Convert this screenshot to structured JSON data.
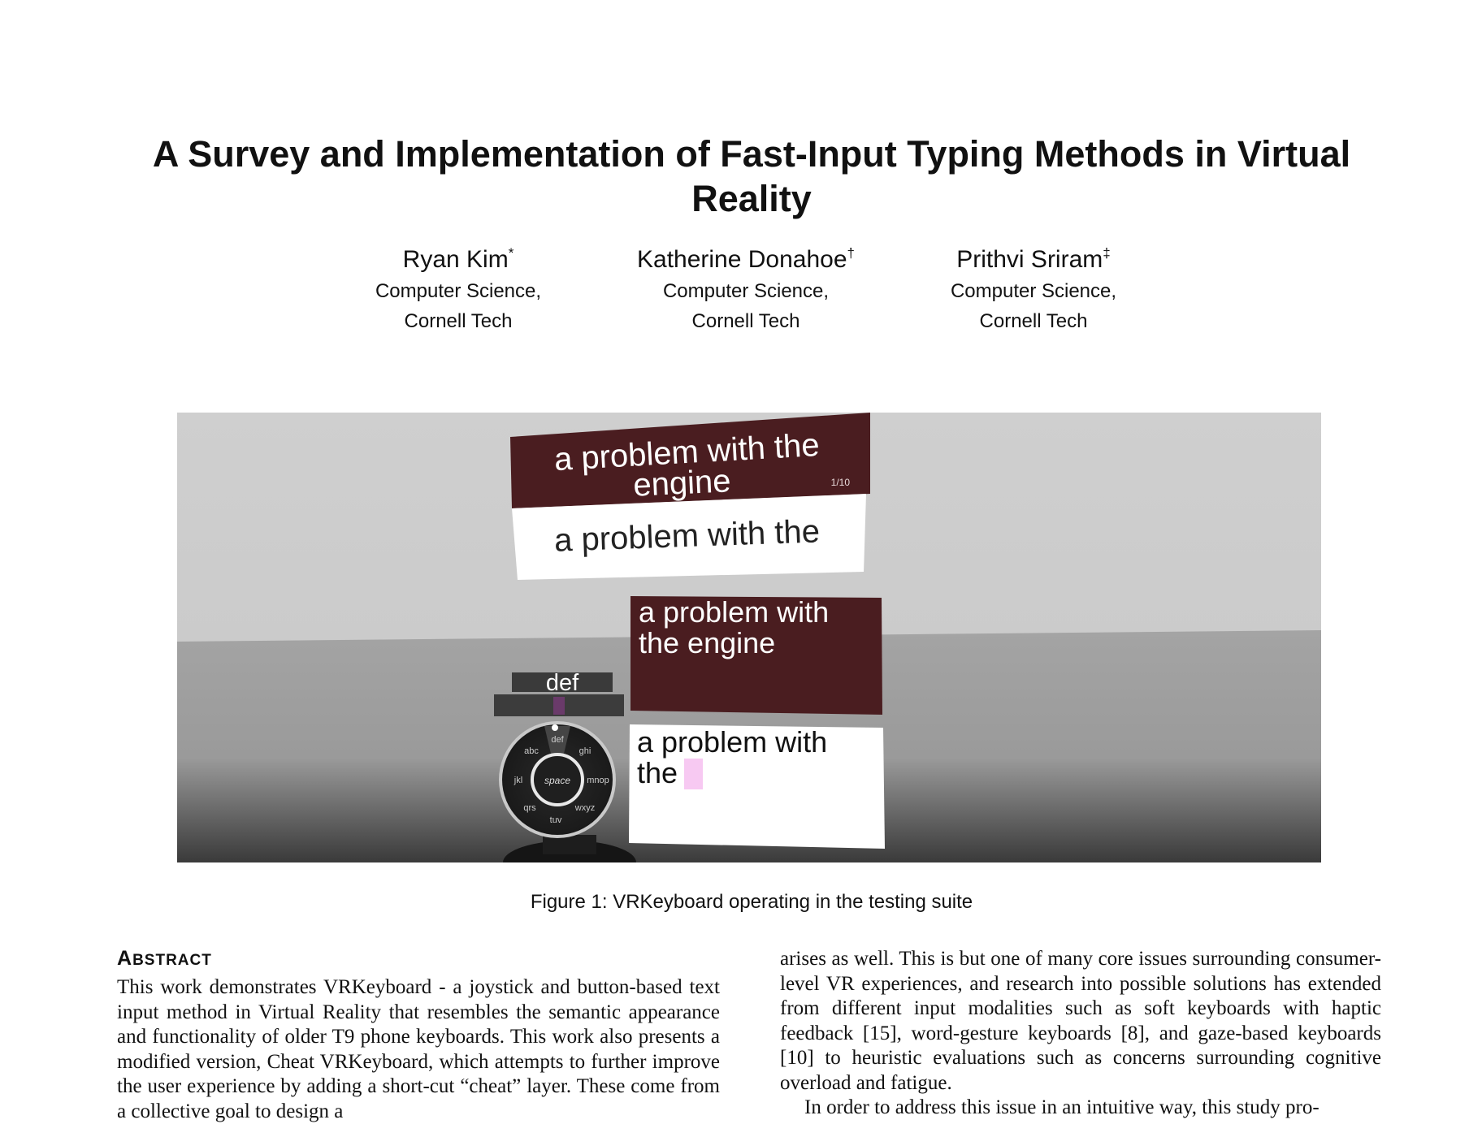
{
  "paper": {
    "title": "A Survey and Implementation of Fast-Input Typing Methods in Virtual Reality",
    "authors": [
      {
        "name": "Ryan Kim",
        "mark": "*",
        "aff1": "Computer Science,",
        "aff2": "Cornell Tech"
      },
      {
        "name": "Katherine Donahoe",
        "mark": "†",
        "aff1": "Computer Science,",
        "aff2": "Cornell Tech"
      },
      {
        "name": "Prithvi Sriram",
        "mark": "‡",
        "aff1": "Computer Science,",
        "aff2": "Cornell Tech"
      }
    ]
  },
  "figure": {
    "caption": "Figure 1: VRKeyboard operating in the testing suite",
    "target_phrase_line1": "a problem with the",
    "target_phrase_line2": "engine",
    "counter": "1/10",
    "typed_phrase": "a problem with the",
    "panel2_target_line1": "a problem with",
    "panel2_target_line2": "the engine",
    "panel2_typed_line1": "a problem with",
    "panel2_typed_line2": "the",
    "selected_group": "def",
    "dial": {
      "center": "space",
      "groups": [
        "def",
        "ghi",
        "mnop",
        "wxyz",
        "tuv",
        "qrs",
        "jkl",
        "abc"
      ]
    },
    "colors": {
      "wall": "#cdcdcd",
      "floor": "#9e9e9e",
      "panel_dark": "#4a1d20",
      "cursor": "#f7c9f2"
    }
  },
  "abstract": {
    "heading_first": "A",
    "heading_rest": "BSTRACT",
    "text": "This work demonstrates VRKeyboard - a joystick and button-based text input method in Virtual Reality that resembles the semantic appearance and functionality of older T9 phone keyboards. This work also presents a modified version, Cheat VRKeyboard, which attempts to further improve the user experience by adding a short-cut “cheat” layer. These come from a collective goal to design a"
  },
  "right_column": {
    "para1": "arises as well. This is but one of many core issues surrounding consumer-level VR experiences, and research into possible solutions has extended from different input modalities such as soft keyboards with haptic feedback [15], word-gesture keyboards [8], and gaze-based keyboards [10] to heuristic evaluations such as concerns surrounding cognitive overload and fatigue.",
    "para2": "In order to address this issue in an intuitive way, this study pro-"
  }
}
